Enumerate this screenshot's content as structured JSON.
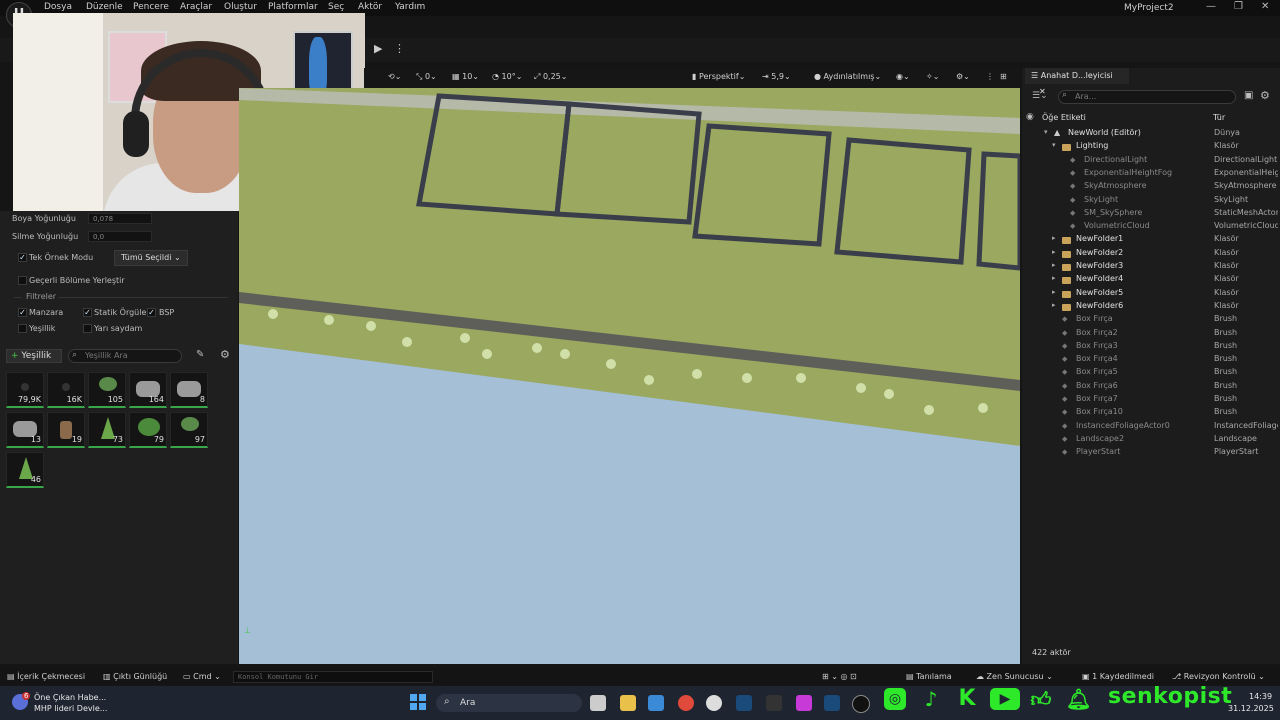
{
  "menubar": {
    "items": [
      "Dosya",
      "Düzenle",
      "Pencere",
      "Araçlar",
      "Oluştur",
      "Platformlar",
      "Seç",
      "Aktör",
      "Yardım"
    ],
    "project": "MyProject2"
  },
  "foliage_panel": {
    "paint_density_label": "Boya Yoğunluğu",
    "paint_density_value": "0,078",
    "erase_density_label": "Silme Yoğunluğu",
    "erase_density_value": "0,0",
    "single_instance_label": "Tek Örnek Modu",
    "single_instance_dropdown": "Tümü Seçildi",
    "place_in_level_label": "Geçerli Bölüme Yerleştir",
    "filters_header": "Filtreler",
    "filters": [
      {
        "label": "Manzara",
        "checked": true
      },
      {
        "label": "Statik Örgüler",
        "checked": true
      },
      {
        "label": "BSP",
        "checked": true
      },
      {
        "label": "Yeşillik",
        "checked": false
      },
      {
        "label": "Yarı saydam",
        "checked": false
      }
    ],
    "add_button": "Yeşillik",
    "search_placeholder": "Yeşillik Ara",
    "tiles": [
      "79,9K",
      "16K",
      "105",
      "164",
      "8",
      "13",
      "19",
      "73",
      "79",
      "97",
      "46"
    ]
  },
  "viewport_toolbar": {
    "rotate_snap": "0",
    "grid_snap": "10",
    "angle_snap": "10°",
    "scale_snap": "0,25",
    "view_mode": "Perspektif",
    "camera_speed": "5,9",
    "lighting_mode": "Aydınlatılmış"
  },
  "outliner": {
    "tab_title": "Anahat D...leyicisi",
    "search_placeholder": "Ara...",
    "col_label": "Öğe Etiketi",
    "col_type": "Tür",
    "rows": [
      {
        "label": "NewWorld (Editör)",
        "type": "Dünya",
        "indent": 0,
        "kind": "world"
      },
      {
        "label": "Lighting",
        "type": "Klasör",
        "indent": 1,
        "kind": "folder-open"
      },
      {
        "label": "DirectionalLight",
        "type": "DirectionalLight",
        "indent": 2,
        "kind": "dim"
      },
      {
        "label": "ExponentialHeightFog",
        "type": "ExponentialHeig",
        "indent": 2,
        "kind": "dim"
      },
      {
        "label": "SkyAtmosphere",
        "type": "SkyAtmosphere",
        "indent": 2,
        "kind": "dim"
      },
      {
        "label": "SkyLight",
        "type": "SkyLight",
        "indent": 2,
        "kind": "dim"
      },
      {
        "label": "SM_SkySphere",
        "type": "StaticMeshActor",
        "indent": 2,
        "kind": "dim"
      },
      {
        "label": "VolumetricCloud",
        "type": "VolumetricCloud",
        "indent": 2,
        "kind": "dim"
      },
      {
        "label": "NewFolder1",
        "type": "Klasör",
        "indent": 1,
        "kind": "folder"
      },
      {
        "label": "NewFolder2",
        "type": "Klasör",
        "indent": 1,
        "kind": "folder"
      },
      {
        "label": "NewFolder3",
        "type": "Klasör",
        "indent": 1,
        "kind": "folder"
      },
      {
        "label": "NewFolder4",
        "type": "Klasör",
        "indent": 1,
        "kind": "folder"
      },
      {
        "label": "NewFolder5",
        "type": "Klasör",
        "indent": 1,
        "kind": "folder"
      },
      {
        "label": "NewFolder6",
        "type": "Klasör",
        "indent": 1,
        "kind": "folder"
      },
      {
        "label": "Box Fırça",
        "type": "Brush",
        "indent": 1,
        "kind": "dim"
      },
      {
        "label": "Box Fırça2",
        "type": "Brush",
        "indent": 1,
        "kind": "dim"
      },
      {
        "label": "Box Fırça3",
        "type": "Brush",
        "indent": 1,
        "kind": "dim"
      },
      {
        "label": "Box Fırça4",
        "type": "Brush",
        "indent": 1,
        "kind": "dim"
      },
      {
        "label": "Box Fırça5",
        "type": "Brush",
        "indent": 1,
        "kind": "dim"
      },
      {
        "label": "Box Fırça6",
        "type": "Brush",
        "indent": 1,
        "kind": "dim"
      },
      {
        "label": "Box Fırça7",
        "type": "Brush",
        "indent": 1,
        "kind": "dim"
      },
      {
        "label": "Box Fırça10",
        "type": "Brush",
        "indent": 1,
        "kind": "dim"
      },
      {
        "label": "InstancedFoliageActor0",
        "type": "InstancedFoliage",
        "indent": 1,
        "kind": "dim"
      },
      {
        "label": "Landscape2",
        "type": "Landscape",
        "indent": 1,
        "kind": "dim"
      },
      {
        "label": "PlayerStart",
        "type": "PlayerStart",
        "indent": 1,
        "kind": "dim"
      }
    ],
    "actor_count": "422 aktör"
  },
  "statusbar": {
    "content_drawer": "İçerik Çekmecesi",
    "output_log": "Çıktı Günlüğü",
    "cmd": "Cmd",
    "console_placeholder": "Konsol Komutunu Gir",
    "diagnostics": "Tanılama",
    "zen_server": "Zen Sunucusu",
    "saved": "1 Kaydedilmedi",
    "revision": "Revizyon Kontrolü"
  },
  "taskbar": {
    "news_title": "Öne Çıkan Habe...",
    "news_sub": "MHP lideri Devle...",
    "news_badge": "6",
    "search": "Ara",
    "time": "14:39",
    "date": "31.12.2025",
    "overlay_name": "senkopist"
  },
  "colors": {
    "accent_green": "#2ee82a",
    "sky": "#a4bfd6",
    "grass": "#9aa860",
    "folder": "#c9a35a"
  }
}
